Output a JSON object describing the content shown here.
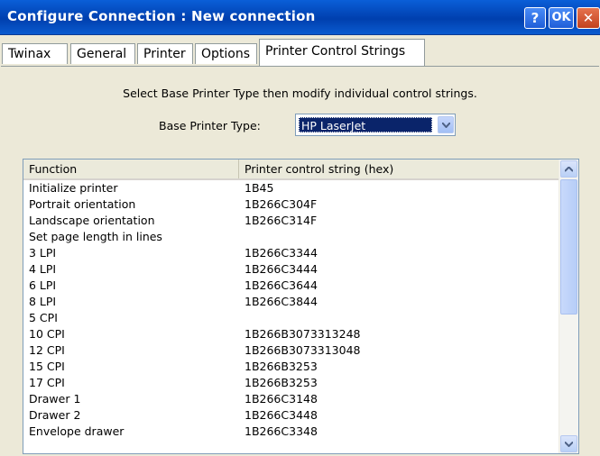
{
  "window": {
    "title": "Configure Connection : New connection",
    "help_label": "?",
    "ok_label": "OK",
    "close_label": "✕"
  },
  "tabs": [
    {
      "label": "Twinax"
    },
    {
      "label": "General"
    },
    {
      "label": "Printer"
    },
    {
      "label": "Options"
    },
    {
      "label": "Printer Control Strings",
      "active": true
    }
  ],
  "panel": {
    "instruction": "Select Base Printer Type then modify individual control strings.",
    "base_printer_label": "Base Printer Type:",
    "base_printer_value": "HP LaserJet"
  },
  "table": {
    "columns": [
      "Function",
      "Printer control string (hex)"
    ],
    "rows": [
      {
        "function": "Initialize printer",
        "hex": "1B45"
      },
      {
        "function": "Portrait orientation",
        "hex": "1B266C304F"
      },
      {
        "function": "Landscape orientation",
        "hex": "1B266C314F"
      },
      {
        "function": "Set page length in lines",
        "hex": ""
      },
      {
        "function": "3 LPI",
        "hex": "1B266C3344"
      },
      {
        "function": "4 LPI",
        "hex": "1B266C3444"
      },
      {
        "function": "6 LPI",
        "hex": "1B266C3644"
      },
      {
        "function": "8 LPI",
        "hex": "1B266C3844"
      },
      {
        "function": "5 CPI",
        "hex": ""
      },
      {
        "function": "10 CPI",
        "hex": "1B266B3073313248"
      },
      {
        "function": "12 CPI",
        "hex": "1B266B3073313048"
      },
      {
        "function": "15 CPI",
        "hex": "1B266B3253"
      },
      {
        "function": "17 CPI",
        "hex": "1B266B3253"
      },
      {
        "function": "Drawer 1",
        "hex": "1B266C3148"
      },
      {
        "function": "Drawer 2",
        "hex": "1B266C3448"
      },
      {
        "function": "Envelope drawer",
        "hex": "1B266C3348"
      }
    ]
  },
  "colors": {
    "titlebar": "#0a5fd8",
    "selection": "#0a246a",
    "dialog_bg": "#ece9d8"
  }
}
